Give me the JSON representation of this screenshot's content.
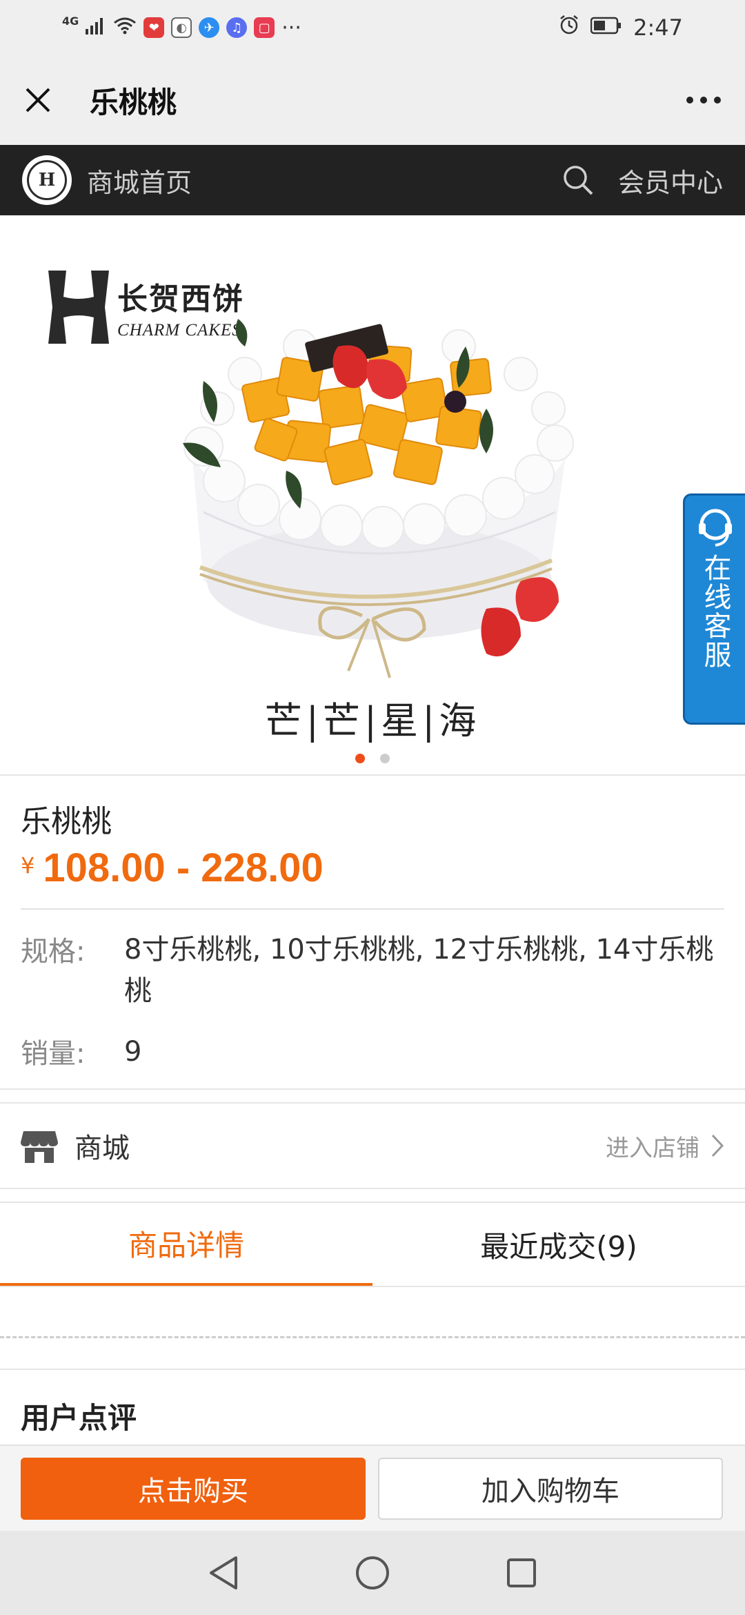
{
  "status_bar": {
    "network": "4G",
    "more": "···",
    "time": "2:47"
  },
  "webview": {
    "title": "乐桃桃"
  },
  "site_nav": {
    "logo_letter": "H",
    "home_label": "商城首页",
    "member_label": "会员中心"
  },
  "gallery": {
    "brand_cn": "长贺西饼",
    "brand_en": "CHARM CAKES",
    "caption": "芒|芒|星|海",
    "slide_count": 2,
    "active_slide": 1
  },
  "service": {
    "label": "在线客服"
  },
  "product": {
    "name": "乐桃桃",
    "currency": "¥",
    "price_range": "108.00 - 228.00",
    "spec_label": "规格:",
    "spec_value": "8寸乐桃桃, 10寸乐桃桃, 12寸乐桃桃, 14寸乐桃桃",
    "sales_label": "销量:",
    "sales_value": "9"
  },
  "shop": {
    "name": "商城",
    "enter_label": "进入店铺"
  },
  "tabs": [
    {
      "label": "商品详情",
      "active": true
    },
    {
      "label": "最近成交(9)",
      "active": false
    }
  ],
  "reviews": {
    "title": "用户点评"
  },
  "actions": {
    "buy_label": "点击购买",
    "cart_label": "加入购物车"
  },
  "colors": {
    "accent": "#f06a0f",
    "nav_bg": "#222222",
    "service_bg": "#1f88d6"
  }
}
